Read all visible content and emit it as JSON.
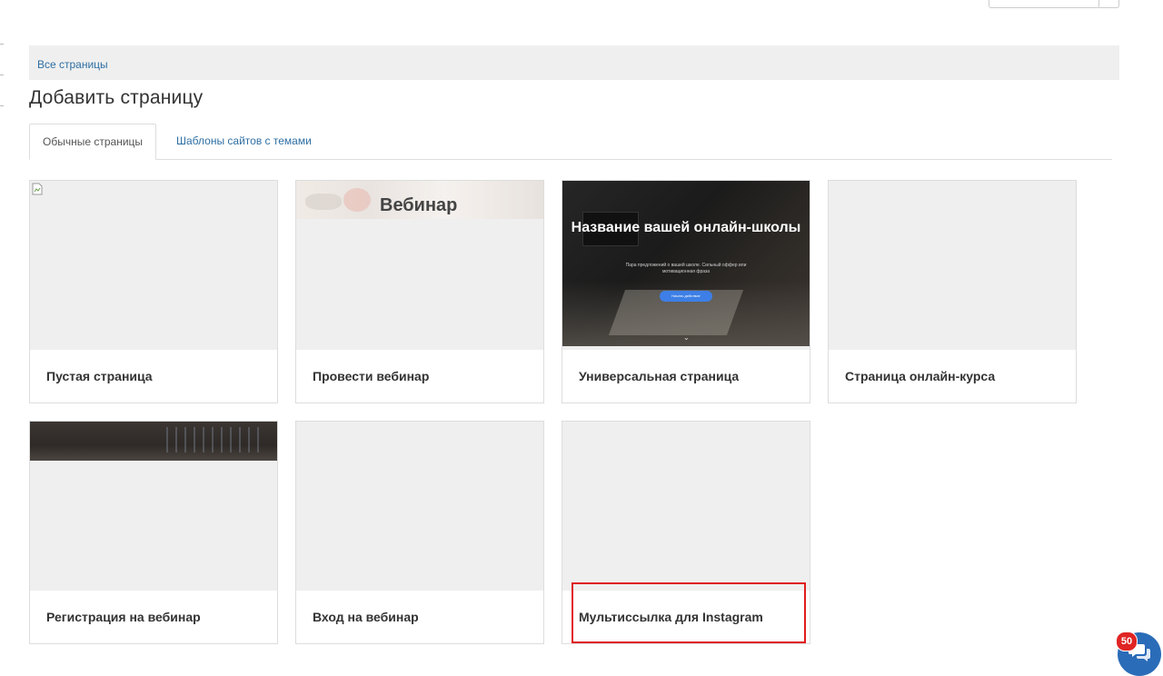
{
  "breadcrumb": {
    "all_pages": "Все страницы"
  },
  "page_title": "Добавить страницу",
  "tabs": [
    {
      "label": "Обычные страницы",
      "active": true
    },
    {
      "label": "Шаблоны сайтов с темами",
      "active": false
    }
  ],
  "cards": [
    {
      "label": "Пустая страница",
      "thumb": "broken-image"
    },
    {
      "label": "Провести вебинар",
      "thumb_title": "Вебинар"
    },
    {
      "label": "Универсальная страница",
      "hero_title": "Название вашей онлайн-школы",
      "hero_subtitle": "Пара предложений о вашей школе. Сильный оффер или мотивационная фраза",
      "hero_button": "Начать действие"
    },
    {
      "label": "Страница онлайн-курса"
    },
    {
      "label": "Регистрация на вебинар"
    },
    {
      "label": "Вход на вебинар"
    },
    {
      "label": "Мультиссылка для Instagram",
      "highlighted": true
    }
  ],
  "chat": {
    "badge_count": "50"
  },
  "colors": {
    "link": "#2f6fa3",
    "thumb_bg": "#efefef",
    "highlight": "#e01b1b",
    "chat": "#2b6cb8",
    "badge": "#e02424",
    "cta": "#3d7fe6"
  }
}
